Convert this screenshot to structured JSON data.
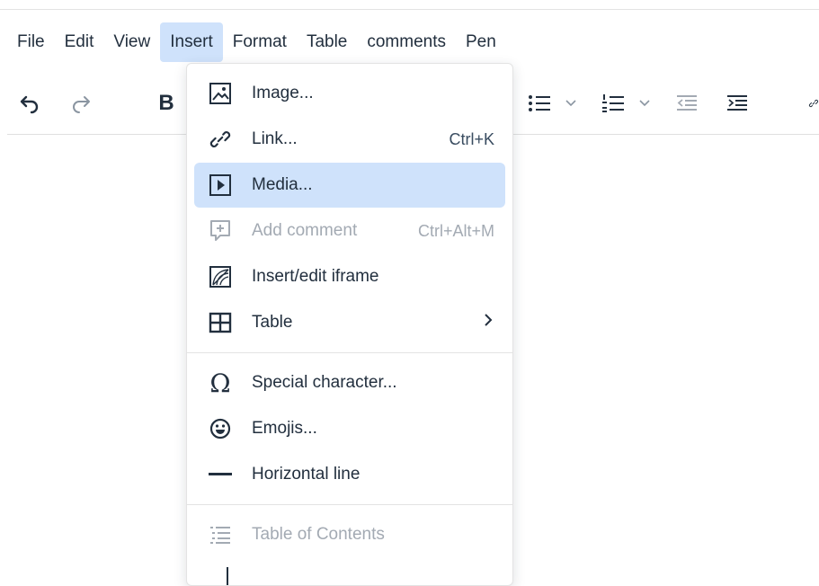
{
  "menubar": {
    "items": [
      "File",
      "Edit",
      "View",
      "Insert",
      "Format",
      "Table",
      "comments",
      "Pen"
    ],
    "active": "Insert"
  },
  "toolbar": {
    "bold_label": "B"
  },
  "insert_menu": {
    "items": [
      {
        "label": "Image...",
        "icon": "image-icon",
        "shortcut": ""
      },
      {
        "label": "Link...",
        "icon": "link-icon",
        "shortcut": "Ctrl+K"
      },
      {
        "label": "Media...",
        "icon": "media-icon",
        "shortcut": "",
        "highlighted": true
      },
      {
        "label": "Add comment",
        "icon": "add-comment-icon",
        "shortcut": "Ctrl+Alt+M",
        "disabled": true
      },
      {
        "label": "Insert/edit iframe",
        "icon": "iframe-icon",
        "shortcut": ""
      },
      {
        "label": "Table",
        "icon": "table-icon",
        "shortcut": "",
        "submenu": true
      },
      {
        "label": "Special character...",
        "icon": "omega-icon",
        "shortcut": ""
      },
      {
        "label": "Emojis...",
        "icon": "emoji-icon",
        "shortcut": ""
      },
      {
        "label": "Horizontal line",
        "icon": "horizontal-line-icon",
        "shortcut": ""
      },
      {
        "label": "Table of Contents",
        "icon": "toc-icon",
        "shortcut": "",
        "disabled": true
      }
    ]
  },
  "colors": {
    "highlight": "#cfe2fb",
    "text": "#222f3e",
    "disabled_text": "#a3aab3"
  }
}
